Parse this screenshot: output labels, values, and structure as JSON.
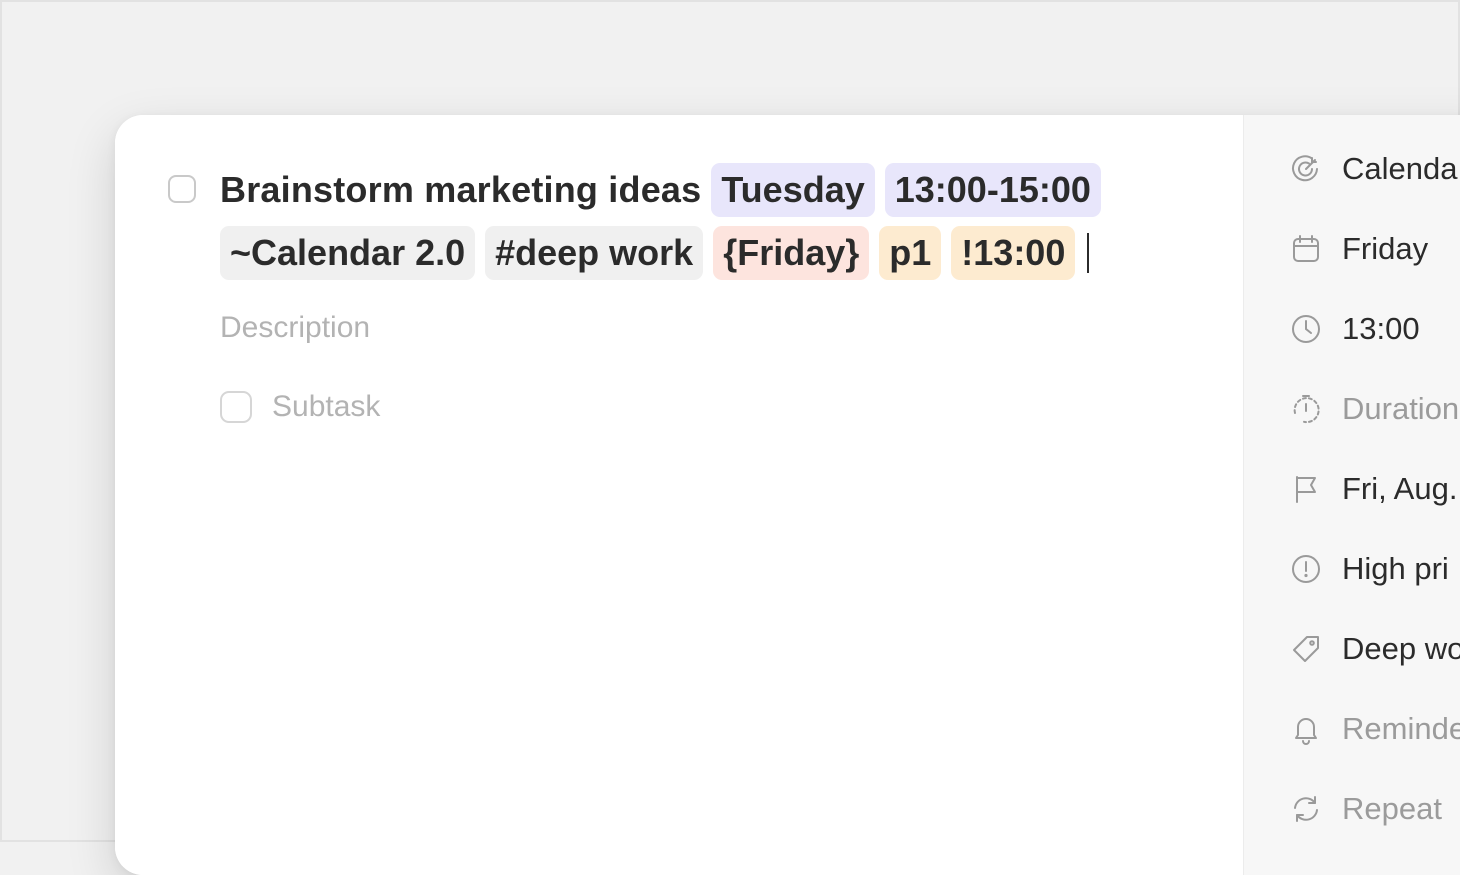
{
  "task": {
    "title": "Brainstorm marketing ideas",
    "chips_line1": [
      {
        "text": "Tuesday",
        "color": "#e8e6fb"
      },
      {
        "text": "13:00-15:00",
        "color": "#e8e6fb"
      }
    ],
    "chips_line2": [
      {
        "text": "~Calendar 2.0",
        "color": "#f0f0f0"
      },
      {
        "text": "#deep work",
        "color": "#f0f0f0"
      },
      {
        "text": "{Friday}",
        "color": "#fde4de"
      },
      {
        "text": "p1",
        "color": "#fdebd0"
      },
      {
        "text": "!13:00",
        "color": "#fdebd0"
      }
    ],
    "description_placeholder": "Description",
    "subtask_placeholder": "Subtask"
  },
  "sidebar": {
    "items": [
      {
        "icon": "calendar-target-icon",
        "label": "Calenda",
        "muted": false
      },
      {
        "icon": "calendar-icon",
        "label": "Friday",
        "muted": false
      },
      {
        "icon": "clock-icon",
        "label": "13:00",
        "muted": false
      },
      {
        "icon": "timer-icon",
        "label": "Duration",
        "muted": true
      },
      {
        "icon": "flag-icon",
        "label": "Fri, Aug.",
        "muted": false
      },
      {
        "icon": "priority-icon",
        "label": "High pri",
        "muted": false
      },
      {
        "icon": "tag-icon",
        "label": "Deep wo",
        "muted": false
      },
      {
        "icon": "bell-icon",
        "label": "Reminde",
        "muted": true
      },
      {
        "icon": "repeat-icon",
        "label": "Repeat",
        "muted": true
      }
    ]
  },
  "colors": {
    "text": "#2b2b2b",
    "muted": "#9b9b9b",
    "placeholder": "#b3b3b3",
    "chip_purple": "#e8e6fb",
    "chip_gray": "#f0f0f0",
    "chip_red": "#fde4de",
    "chip_orange": "#fdebd0"
  }
}
